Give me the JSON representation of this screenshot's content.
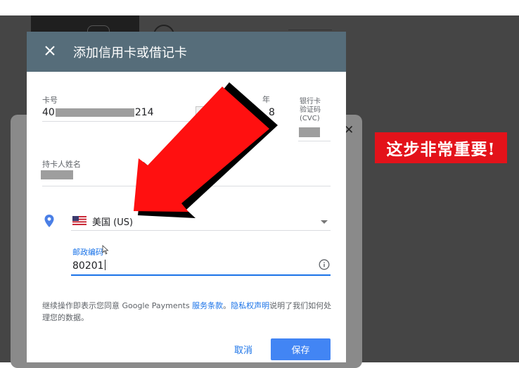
{
  "dialog": {
    "title": "添加信用卡或借记卡",
    "card_number": {
      "label": "卡号",
      "prefix": "40",
      "suffix": "214"
    },
    "expiry": {
      "year_label": "年",
      "year_digit": "8"
    },
    "cvc": {
      "label_line1": "银行卡",
      "label_line2": "验证码",
      "label_line3": "(CVC)"
    },
    "cardholder": {
      "label": "持卡人姓名"
    },
    "country": {
      "value": "美国 (US)"
    },
    "postal_code": {
      "label": "邮政编码",
      "value": "80201"
    },
    "terms": {
      "text_before": "继续操作即表示您同意 Google Payments ",
      "terms_link": "服务条款",
      "separator": "。",
      "privacy_link": "隐私权声明",
      "text_after": "说明了我们如何处理您的数据。"
    },
    "buttons": {
      "cancel": "取消",
      "save": "保存"
    }
  },
  "callout": {
    "text": "这步非常重要!"
  },
  "colors": {
    "header": "#566d7a",
    "accent": "#1a73e8",
    "save_button": "#4285f4",
    "arrow": "#ff1010",
    "callout": "#e3121a"
  },
  "icons": [
    "close-icon",
    "location-pin-icon",
    "us-flag-icon",
    "dropdown-arrow-icon",
    "info-icon",
    "mouse-cursor-icon"
  ]
}
